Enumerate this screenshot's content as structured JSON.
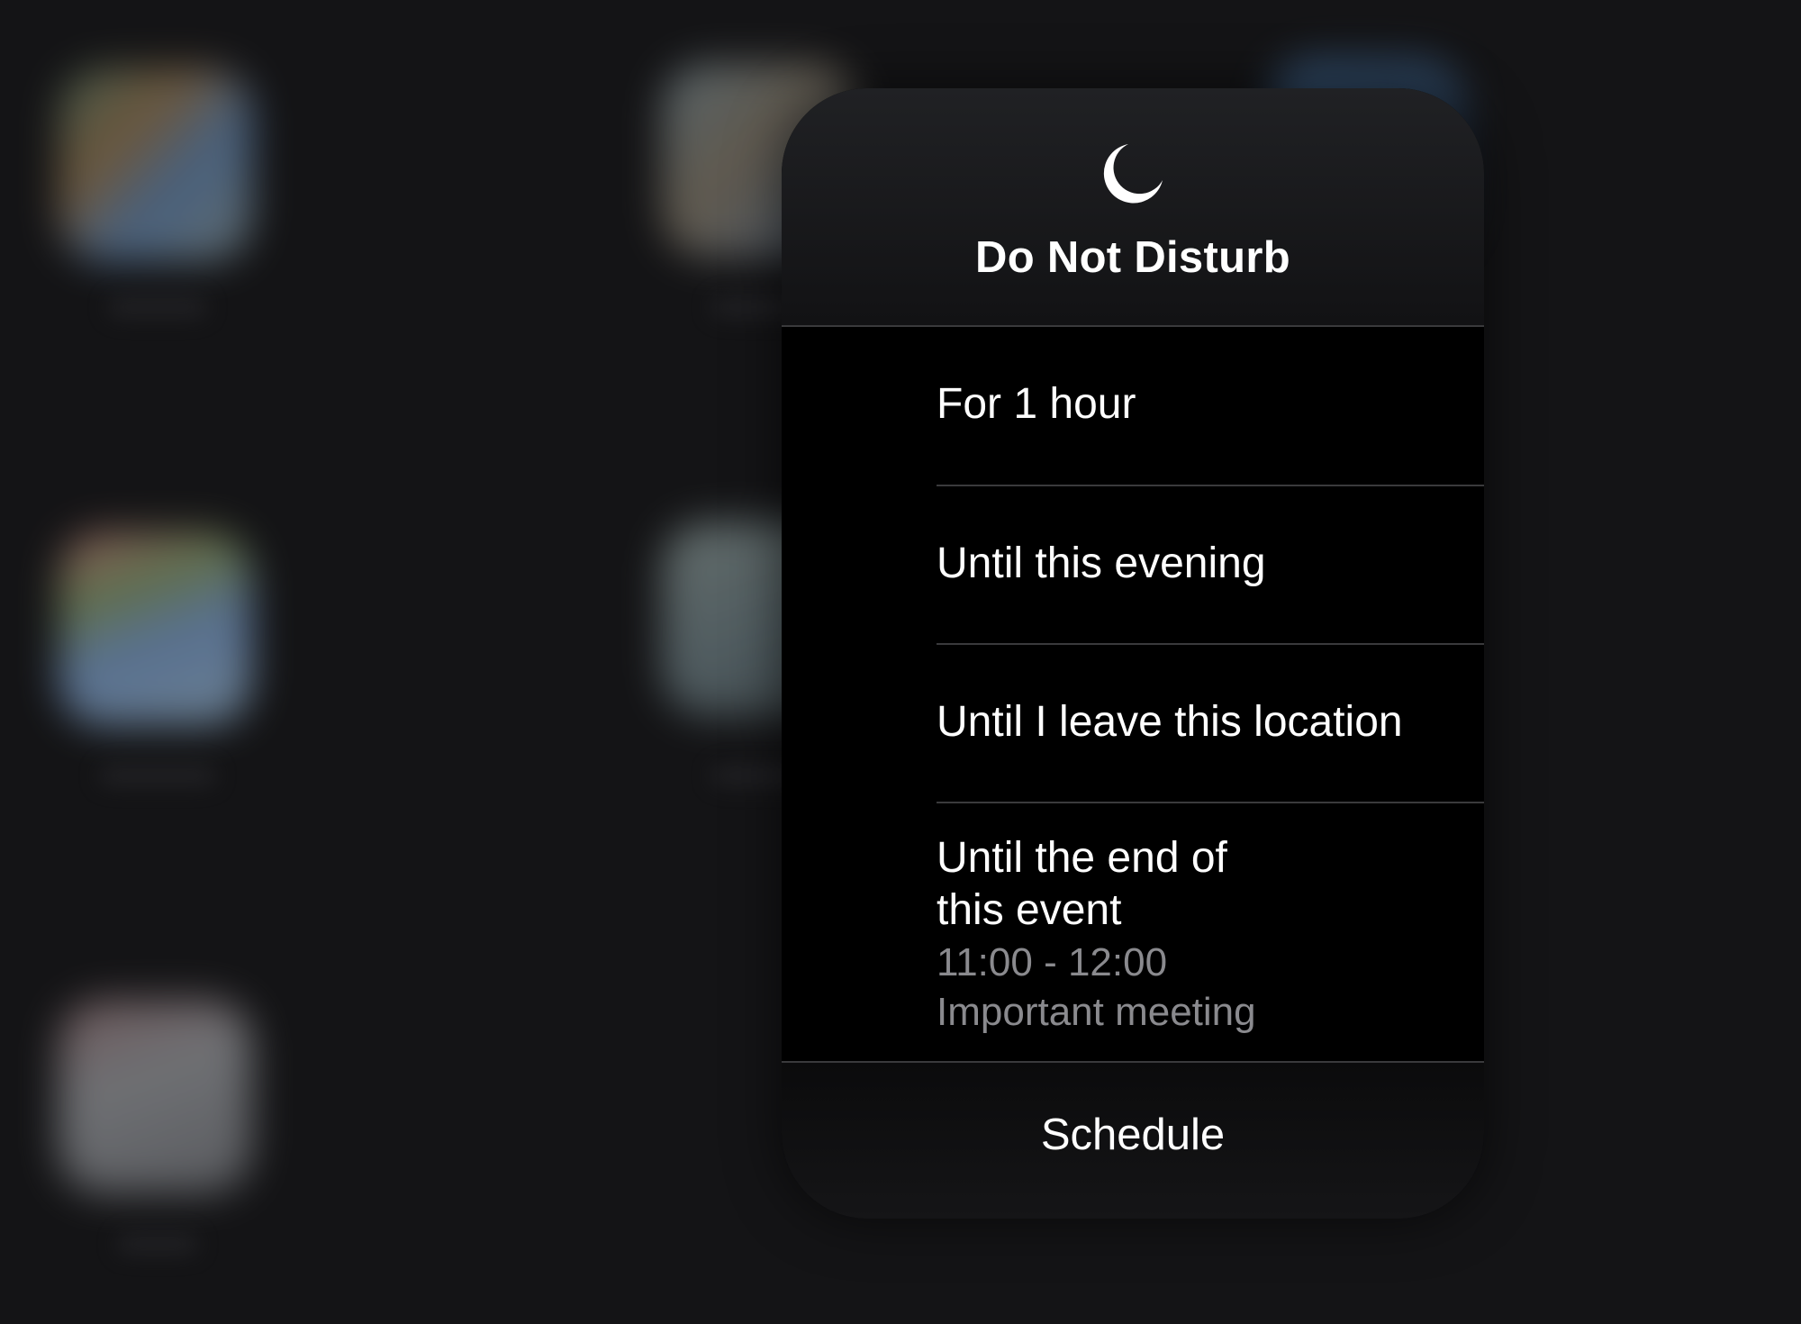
{
  "dnd": {
    "icon": "moon-icon",
    "title": "Do Not Disturb",
    "options": [
      {
        "label": "For 1 hour"
      },
      {
        "label": "Until this evening"
      },
      {
        "label": "Until I leave this location"
      },
      {
        "label_line1": "Until the end of",
        "label_line2": "this event",
        "time": "11:00 - 12:00",
        "event_name": "Important meeting"
      }
    ],
    "schedule_label": "Schedule"
  },
  "colors": {
    "background": "#141416",
    "card": "#000000",
    "text_primary": "#ffffff",
    "text_secondary": "#8a8a8e",
    "separator": "#3a3a3c"
  }
}
